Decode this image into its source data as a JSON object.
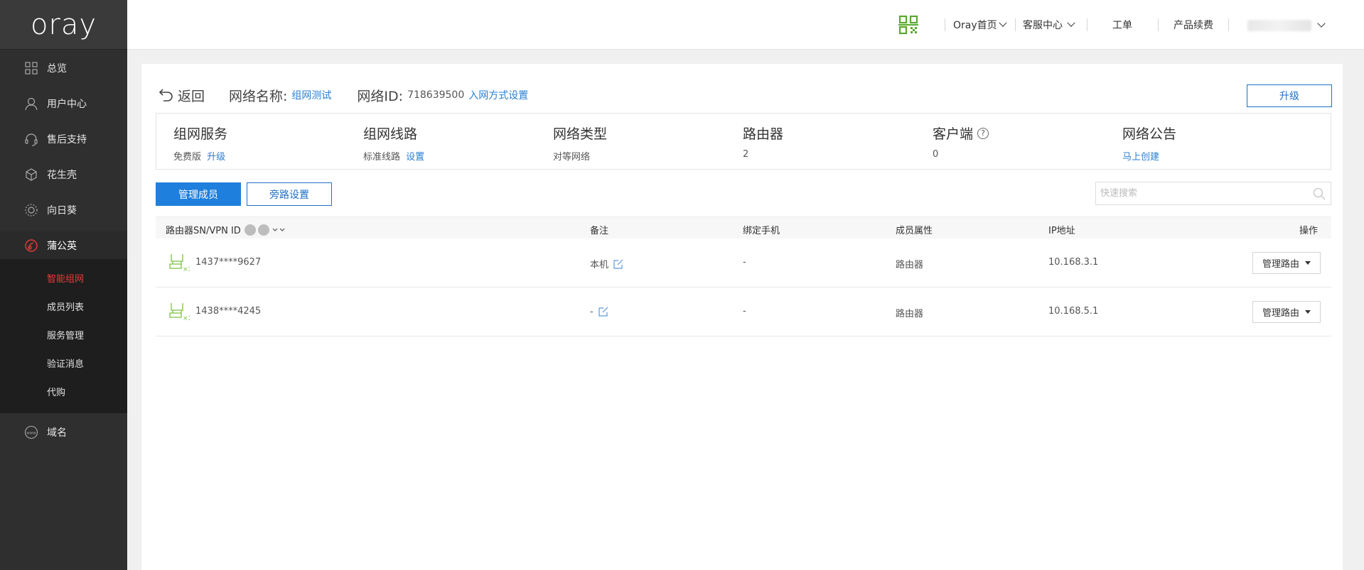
{
  "brand": {
    "logo": "oray"
  },
  "sidebar": {
    "items": [
      {
        "label": "总览",
        "icon": "grid-icon"
      },
      {
        "label": "用户中心",
        "icon": "user-icon"
      },
      {
        "label": "售后支持",
        "icon": "headset-icon"
      },
      {
        "label": "花生壳",
        "icon": "peanut-icon"
      },
      {
        "label": "向日葵",
        "icon": "sunflower-icon"
      },
      {
        "label": "蒲公英",
        "icon": "dandelion-icon"
      },
      {
        "label": "域名",
        "icon": "www-icon"
      }
    ],
    "subitems": [
      {
        "label": "智能组网",
        "active": true
      },
      {
        "label": "成员列表"
      },
      {
        "label": "服务管理"
      },
      {
        "label": "验证消息"
      },
      {
        "label": "代购"
      }
    ]
  },
  "topbar": {
    "qr_icon": "qr-code-icon",
    "links": [
      {
        "label": "Oray首页",
        "dropdown": true
      },
      {
        "label": "客服中心",
        "dropdown": true
      },
      {
        "label": "工单"
      },
      {
        "label": "产品续费"
      }
    ]
  },
  "header": {
    "back_label": "返回",
    "network_name_label": "网络名称:",
    "network_name_value": "组网测试",
    "network_id_label": "网络ID:",
    "network_id_value": "718639500",
    "join_settings_link": "入网方式设置",
    "upgrade_button": "升级"
  },
  "info": [
    {
      "title": "组网服务",
      "value": "免费版",
      "link": "升级"
    },
    {
      "title": "组网线路",
      "value": "标准线路",
      "link": "设置"
    },
    {
      "title": "网络类型",
      "value": "对等网络"
    },
    {
      "title": "路由器",
      "value": "2"
    },
    {
      "title": "客户端",
      "value": "0",
      "help": "?"
    },
    {
      "title": "网络公告",
      "link": "马上创建"
    }
  ],
  "tabs": {
    "manage_members": "管理成员",
    "bypass_settings": "旁路设置"
  },
  "search": {
    "placeholder": "快速搜索"
  },
  "table": {
    "columns": [
      "路由器SN/VPN ID",
      "备注",
      "绑定手机",
      "成员属性",
      "IP地址",
      "操作"
    ],
    "rows": [
      {
        "sn": "1437****9627",
        "note": "本机",
        "phone": "-",
        "attr": "路由器",
        "ip": "10.168.3.1",
        "action": "管理路由"
      },
      {
        "sn": "1438****4245",
        "note": "-",
        "phone": "-",
        "attr": "路由器",
        "ip": "10.168.5.1",
        "action": "管理路由"
      }
    ]
  },
  "colors": {
    "accent": "#1f7fdc",
    "active_red": "#e83a3a",
    "link": "#2a7fd4",
    "router_green": "#7cc142"
  }
}
